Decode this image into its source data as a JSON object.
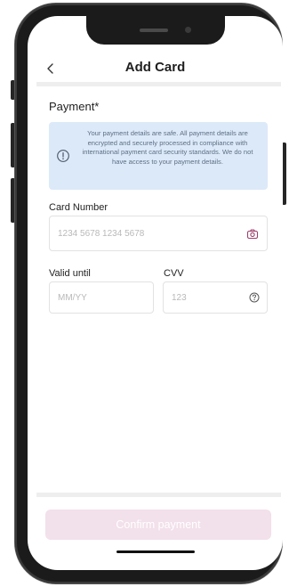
{
  "header": {
    "back_icon": "chevron-left-icon",
    "title": "Add Card"
  },
  "payment": {
    "section_title": "Payment*",
    "info_icon": "info-circle-icon",
    "info_text": "Your payment details are safe. All payment details are encrypted and securely processed in compliance with international payment card security standards. We do not have access to your payment details."
  },
  "card_number": {
    "label": "Card Number",
    "value": "",
    "placeholder": "1234 5678 1234 5678",
    "icon": "camera-icon"
  },
  "valid_until": {
    "label": "Valid until",
    "value": "",
    "placeholder": "MM/YY"
  },
  "cvv": {
    "label": "CVV",
    "value": "",
    "placeholder": "123",
    "icon": "help-circle-icon"
  },
  "footer": {
    "confirm_label": "Confirm payment"
  },
  "colors": {
    "info_background": "#dce9f8",
    "info_text": "#5e6f86",
    "confirm_button_disabled": "#f2e0ea",
    "icon_accent": "#9e3f6c"
  }
}
